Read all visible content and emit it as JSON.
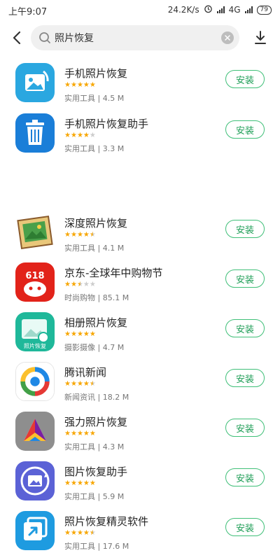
{
  "status_bar": {
    "time": "上午9:07",
    "speed": "24.2K/s",
    "network": "4G",
    "battery": "79",
    "icons": [
      "alarm-icon",
      "signal-icon",
      "signal-icon",
      "battery-icon"
    ]
  },
  "search": {
    "query": "照片恢复",
    "icons": [
      "back-icon",
      "search-icon",
      "clear-icon",
      "download-icon"
    ]
  },
  "apps": [
    {
      "name": "手机照片恢复",
      "rating": 5,
      "category": "实用工具",
      "size": "4.5 M",
      "install_label": "安装"
    },
    {
      "name": "手机照片恢复助手",
      "rating": 4,
      "category": "实用工具",
      "size": "3.3 M",
      "install_label": "安装"
    },
    {
      "name": "深度照片恢复",
      "rating": 4.5,
      "category": "实用工具",
      "size": "4.1 M",
      "install_label": "安装"
    },
    {
      "name": "京东-全球年中购物节",
      "rating": 2.5,
      "category": "时尚购物",
      "size": "85.1 M",
      "install_label": "安装",
      "icon_text": "618"
    },
    {
      "name": "相册照片恢复",
      "rating": 5,
      "category": "摄影摄像",
      "size": "4.7 M",
      "install_label": "安装",
      "icon_text": "照片恢复"
    },
    {
      "name": "腾讯新闻",
      "rating": 4.5,
      "category": "新闻资讯",
      "size": "18.2 M",
      "install_label": "安装"
    },
    {
      "name": "强力照片恢复",
      "rating": 5,
      "category": "实用工具",
      "size": "4.3 M",
      "install_label": "安装"
    },
    {
      "name": "图片恢复助手",
      "rating": 5,
      "category": "实用工具",
      "size": "5.9 M",
      "install_label": "安装"
    },
    {
      "name": "照片恢复精灵软件",
      "rating": 4.5,
      "category": "实用工具",
      "size": "17.6 M",
      "install_label": "安装"
    }
  ],
  "colors": {
    "accent_green": "#3fbf78",
    "star": "#f7a600"
  }
}
